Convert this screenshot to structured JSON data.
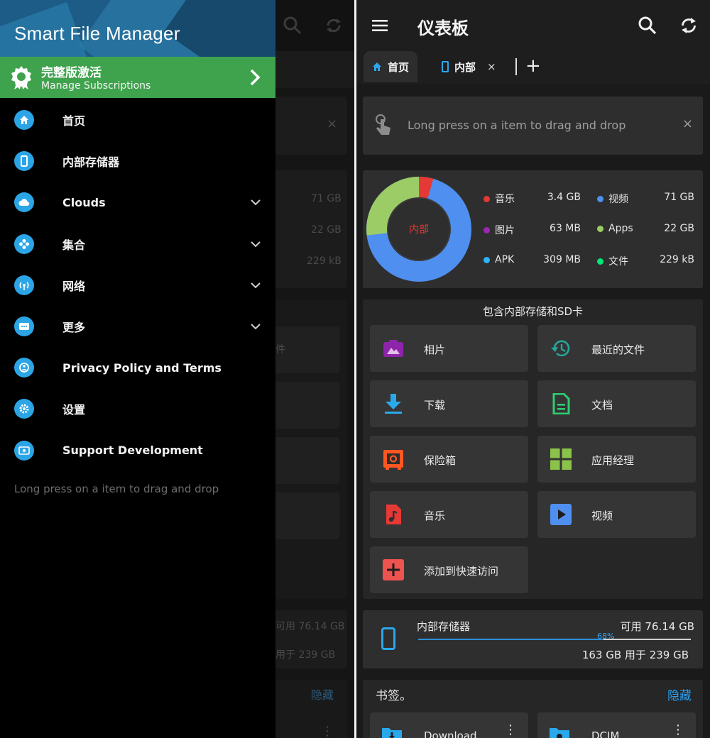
{
  "drawer": {
    "title": "Smart File Manager",
    "promo": {
      "title": "完整版激活",
      "subtitle": "Manage Subscriptions"
    },
    "items": [
      {
        "label": "首页",
        "icon": "home-icon",
        "has_chevron": false
      },
      {
        "label": "内部存储器",
        "icon": "phone-icon",
        "has_chevron": false
      },
      {
        "label": "Clouds",
        "icon": "cloud-icon",
        "has_chevron": true
      },
      {
        "label": "集合",
        "icon": "collection-icon",
        "has_chevron": true
      },
      {
        "label": "网络",
        "icon": "network-icon",
        "has_chevron": true
      },
      {
        "label": "更多",
        "icon": "more-icon",
        "has_chevron": true
      },
      {
        "label": "Privacy Policy and Terms",
        "icon": "privacy-icon",
        "has_chevron": false
      },
      {
        "label": "设置",
        "icon": "gear-icon",
        "has_chevron": false
      },
      {
        "label": "Support Development",
        "icon": "support-icon",
        "has_chevron": false
      }
    ],
    "hint": "Long press on a item to drag and drop"
  },
  "dimmed": {
    "values": [
      "71 GB",
      "22 GB",
      "229 kB"
    ],
    "files_partial": "件",
    "free_partial": "可用 76.14 GB",
    "used_partial": "用于 239 GB",
    "hide_partial": "隐藏"
  },
  "appbar": {
    "title": "仪表板"
  },
  "tabs": {
    "home": "首页",
    "internal": "内部",
    "close": "×",
    "add": "+"
  },
  "hint_card": {
    "text": "Long press on a item to drag and drop",
    "close": "×"
  },
  "storage": {
    "center_label": "内部",
    "legend": [
      {
        "name": "音乐",
        "value": "3.4 GB",
        "color": "#e53935"
      },
      {
        "name": "视频",
        "value": "71 GB",
        "color": "#4f8ff0"
      },
      {
        "name": "图片",
        "value": "63 MB",
        "color": "#9c27b0"
      },
      {
        "name": "Apps",
        "value": "22 GB",
        "color": "#9ccc65"
      },
      {
        "name": "APK",
        "value": "309 MB",
        "color": "#29b6f6"
      },
      {
        "name": "文件",
        "value": "229 kB",
        "color": "#00e676"
      }
    ]
  },
  "quick_access": {
    "title": "包含内部存储和SD卡",
    "items": [
      {
        "label": "相片",
        "icon": "photo-icon"
      },
      {
        "label": "最近的文件",
        "icon": "history-icon"
      },
      {
        "label": "下载",
        "icon": "download-icon"
      },
      {
        "label": "文档",
        "icon": "document-icon"
      },
      {
        "label": "保险箱",
        "icon": "safe-icon"
      },
      {
        "label": "应用经理",
        "icon": "apps-grid-icon"
      },
      {
        "label": "音乐",
        "icon": "music-icon"
      },
      {
        "label": "视频",
        "icon": "video-icon"
      },
      {
        "label": "添加到快速访问",
        "icon": "add-icon"
      }
    ]
  },
  "internal_storage": {
    "title": "内部存储器",
    "free": "可用 76.14 GB",
    "percent_label": "68%",
    "percent": 68,
    "used": "163 GB 用于 239 GB"
  },
  "bookmarks": {
    "title": "书签。",
    "hide": "隐藏",
    "items": [
      {
        "label": "Download",
        "icon": "folder-download-icon"
      },
      {
        "label": "DCIM",
        "icon": "folder-camera-icon"
      }
    ]
  },
  "colors": {
    "accent": "#2aa8ec",
    "promo_green": "#3fa34d",
    "link_blue": "#2b9ff0"
  }
}
